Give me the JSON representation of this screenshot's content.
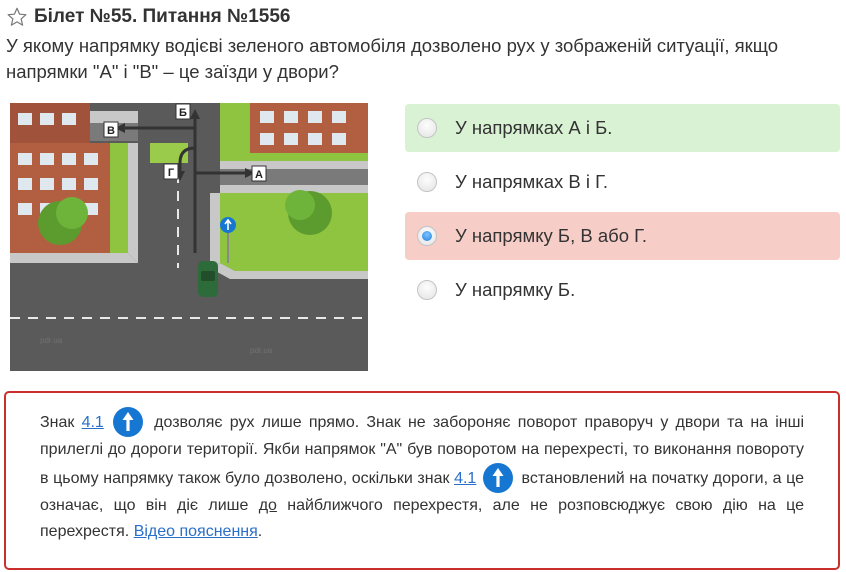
{
  "header": {
    "title": "Білет №55. Питання №1556",
    "star_icon": "star-outline-icon"
  },
  "question": {
    "text": "У якому напрямку водієві зеленого автомобіля дозволено рух у зображеній ситуації, якщо напрямки \"А\" і \"В\" – це заїзди у двори?"
  },
  "scene": {
    "labels": {
      "a": "А",
      "b": "Б",
      "v": "В",
      "g": "Г"
    },
    "road_sign_icon": "straight-only-sign-icon"
  },
  "answers": [
    {
      "text": "У напрямках А і Б.",
      "state": "correct",
      "selected": false
    },
    {
      "text": "У напрямках В і Г.",
      "state": "neutral",
      "selected": false
    },
    {
      "text": "У напрямку Б, В або Г.",
      "state": "wrong",
      "selected": true
    },
    {
      "text": "У напрямку Б.",
      "state": "neutral",
      "selected": false
    }
  ],
  "explanation": {
    "p1": "Знак ",
    "sign_link_1": "4.1",
    "p2": " дозволяє рух лише прямо. Знак не забороняє поворот праворуч у двори та на інші прилеглі до дороги території. Якби напрямок \"А\" був поворотом на перехресті, то виконання повороту в цьому напрямку також було дозволено, оскільки знак ",
    "sign_link_2": "4.1",
    "p3": " встановлений на початку дороги, а це означає, що він діє лише ",
    "do_text": "до",
    "p4": " найближчого перехрестя, але не розповсюджує свою дію на це перехрестя. ",
    "video_link": "Відео пояснення",
    "p5": ".",
    "sign_icon": "straight-arrow-sign-icon"
  },
  "colors": {
    "correct_bg": "#d9f2d3",
    "wrong_bg": "#f7cdc8",
    "explain_border": "#c9302c",
    "link": "#2a6fc9",
    "sign_blue": "#1677d2"
  }
}
